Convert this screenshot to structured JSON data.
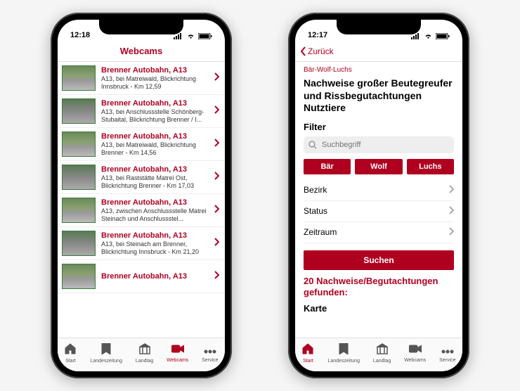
{
  "status": {
    "time_left": "12:18",
    "time_right": "12:17"
  },
  "left": {
    "title": "Webcams",
    "items": [
      {
        "title": "Brenner Autobahn, A13",
        "sub": "A13, bei Matreiwald, Blickrichtung Innsbruck - Km 12,59"
      },
      {
        "title": "Brenner Autobahn, A13",
        "sub": "A13, bei Anschlussstelle Schönberg-Stubaital, Blickrichtung Brenner / I..."
      },
      {
        "title": "Brenner Autobahn, A13",
        "sub": "A13, bei Matreiwald, Blickrichtung Brenner - Km 14,56"
      },
      {
        "title": "Brenner Autobahn, A13",
        "sub": "A13, bei Raststätte Matrei Ost, Blickrichtung Brenner - Km 17,03"
      },
      {
        "title": "Brenner Autobahn, A13",
        "sub": "A13, zwischen Anschlussstelle Matrei Steinach und Anschlussstel..."
      },
      {
        "title": "Brenner Autobahn, A13",
        "sub": "A13, bei Steinach am Brenner, Blickrichtung Innsbruck - Km 21,20"
      },
      {
        "title": "Brenner Autobahn, A13",
        "sub": ""
      }
    ]
  },
  "right": {
    "back": "Zurück",
    "crumb": "Bär-Wolf-Luchs",
    "heading": "Nachweise großer Beutegreufer und Rissbegutachtungen Nutztiere",
    "filter_label": "Filter",
    "search_placeholder": "Suchbegriff",
    "chips": [
      "Bär",
      "Wolf",
      "Luchs"
    ],
    "selects": [
      "Bezirk",
      "Status",
      "Zeitraum"
    ],
    "search_btn": "Suchen",
    "result": "20 Nachweise/Begutachtungen gefunden:",
    "karte": "Karte"
  },
  "tabs": [
    {
      "id": "start",
      "label": "Start"
    },
    {
      "id": "landeszeitung",
      "label": "Landeszeitung"
    },
    {
      "id": "landtag",
      "label": "Landtag"
    },
    {
      "id": "webcams",
      "label": "Webcams"
    },
    {
      "id": "service",
      "label": "Service"
    }
  ],
  "active_tab_left": "webcams",
  "active_tab_right": "start"
}
